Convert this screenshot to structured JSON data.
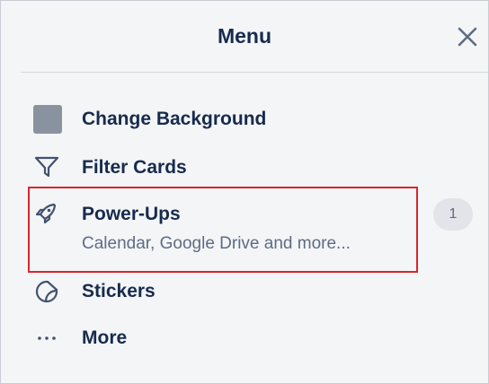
{
  "header": {
    "title": "Menu",
    "close_icon": "close-icon"
  },
  "menu": {
    "change_background": {
      "label": "Change Background",
      "icon": "background-swatch-icon",
      "swatch_color": "#8993a0"
    },
    "filter_cards": {
      "label": "Filter Cards",
      "icon": "filter-icon"
    },
    "power_ups": {
      "label": "Power-Ups",
      "subtitle": "Calendar, Google Drive and more...",
      "badge": "1",
      "icon": "rocket-icon"
    },
    "stickers": {
      "label": "Stickers",
      "icon": "sticker-icon"
    },
    "more": {
      "label": "More",
      "icon": "ellipsis-icon"
    }
  },
  "colors": {
    "panel_background": "#f4f5f7",
    "text_primary": "#172b4d",
    "text_secondary": "#5e6c84",
    "highlight_border": "#d9262b"
  }
}
